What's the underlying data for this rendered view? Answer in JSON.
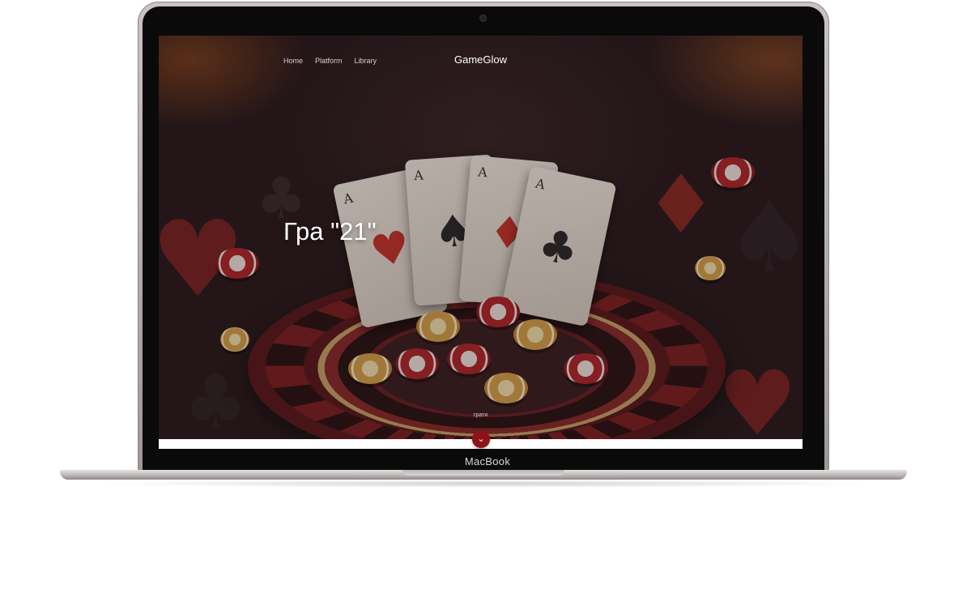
{
  "device": {
    "label": "MacBook"
  },
  "site": {
    "brand": "GameGlow",
    "nav": [
      {
        "label": "Home"
      },
      {
        "label": "Platform"
      },
      {
        "label": "Library"
      }
    ],
    "hero": {
      "title": "Гра \"21\"",
      "play_label": "грати",
      "scroll_icon": "chevron-down-icon"
    },
    "cards": [
      {
        "rank": "A",
        "suit": "♥"
      },
      {
        "rank": "A",
        "suit": "♠"
      },
      {
        "rank": "A",
        "suit": "♦"
      },
      {
        "rank": "A",
        "suit": "♣"
      }
    ],
    "colors": {
      "background": "#2a1a1c",
      "accent": "#8d1318"
    }
  }
}
